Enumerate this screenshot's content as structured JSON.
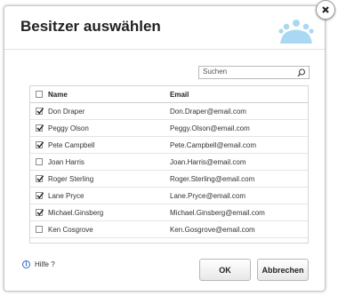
{
  "dialog": {
    "title": "Besitzer auswählen",
    "search_placeholder": "Suchen",
    "columns": {
      "name": "Name",
      "email": "Email"
    },
    "rows": [
      {
        "name": "Don Draper",
        "email": "Don.Draper@email.com",
        "checked": true
      },
      {
        "name": "Peggy Olson",
        "email": "Peggy.Olson@email.com",
        "checked": true
      },
      {
        "name": "Pete Campbell",
        "email": "Pete.Campbell@email.com",
        "checked": true
      },
      {
        "name": "Joan Harris",
        "email": "Joan.Harris@email.com",
        "checked": false
      },
      {
        "name": "Roger Sterling",
        "email": "Roger.Sterling@email.com",
        "checked": true
      },
      {
        "name": "Lane Pryce",
        "email": "Lane.Pryce@email.com",
        "checked": true
      },
      {
        "name": "Michael.Ginsberg",
        "email": "Michael.Ginsberg@email.com",
        "checked": true
      },
      {
        "name": "Ken Cosgrove",
        "email": "Ken.Gosgrove@email.com",
        "checked": false
      }
    ],
    "help_label": "Hilfe ?",
    "ok_label": "OK",
    "cancel_label": "Abbrechen"
  },
  "colors": {
    "accent": "#2f66c8",
    "decor": "#a9d8f2"
  }
}
